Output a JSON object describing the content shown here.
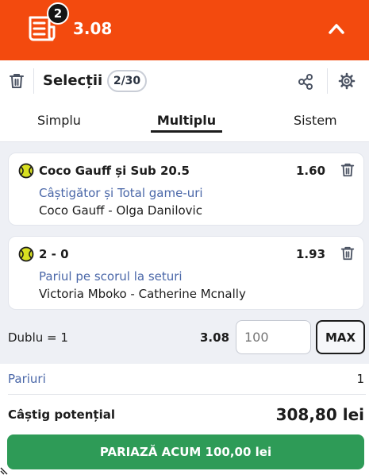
{
  "header": {
    "selection_count": "2",
    "total_odds": "3.08"
  },
  "toolbar": {
    "title": "Selecții",
    "counter": "2/30"
  },
  "tabs": [
    {
      "label": "Simplu",
      "active": false
    },
    {
      "label": "Multiplu",
      "active": true
    },
    {
      "label": "Sistem",
      "active": false
    }
  ],
  "selections": [
    {
      "title": "Coco Gauff și Sub 20.5",
      "odds": "1.60",
      "market": "Câștigător și Total game-uri",
      "event": "Coco Gauff - Olga Danilovic",
      "icon": "tennis-ball-icon"
    },
    {
      "title": "2 - 0",
      "odds": "1.93",
      "market": "Pariul pe scorul la seturi",
      "event": "Victoria Mboko - Catherine Mcnally",
      "icon": "tennis-ball-icon"
    }
  ],
  "combo": {
    "label": "Dublu = 1",
    "odds": "3.08",
    "stake_placeholder": "100",
    "max_label": "MAX"
  },
  "summary": {
    "bets_label": "Pariuri",
    "bets_value": "1",
    "win_label": "Câștig potențial",
    "win_value": "308,80 lei",
    "place_label": "PARIAZĂ ACUM 100,00 lei"
  },
  "colors": {
    "header_bg": "#f34a0e",
    "accent_text": "#4a67a8",
    "cta_bg": "#2e9b57",
    "tennis_ball": "#d8e021"
  }
}
